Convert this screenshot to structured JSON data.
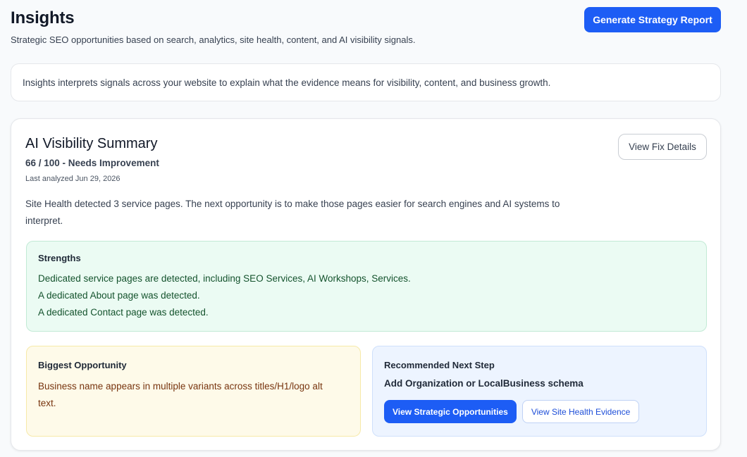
{
  "header": {
    "title": "Insights",
    "subtitle": "Strategic SEO opportunities based on search, analytics, site health, content, and AI visibility signals.",
    "generate_button": "Generate Strategy Report"
  },
  "intro": "Insights interprets signals across your website to explain what the evidence means for visibility, content, and business growth.",
  "summary": {
    "title": "AI Visibility Summary",
    "score": "66 / 100 - Needs Improvement",
    "last_analyzed": "Last analyzed Jun 29, 2026",
    "view_fix_button": "View Fix Details",
    "description": "Site Health detected 3 service pages. The next opportunity is to make those pages easier for search engines and AI systems to interpret.",
    "strengths": {
      "heading": "Strengths",
      "items": [
        "Dedicated service pages are detected, including SEO Services, AI Workshops, Services.",
        "A dedicated About page was detected.",
        "A dedicated Contact page was detected."
      ]
    },
    "opportunity": {
      "heading": "Biggest Opportunity",
      "text": "Business name appears in multiple variants across titles/H1/logo alt text."
    },
    "next_step": {
      "heading": "Recommended Next Step",
      "action": "Add Organization or LocalBusiness schema",
      "primary_button": "View Strategic Opportunities",
      "secondary_button": "View Site Health Evidence"
    }
  },
  "colors": {
    "accent": "#1d5df5",
    "strengths_bg": "#ebfbf3",
    "opportunity_bg": "#fefae9",
    "next_step_bg": "#edf4ff"
  }
}
